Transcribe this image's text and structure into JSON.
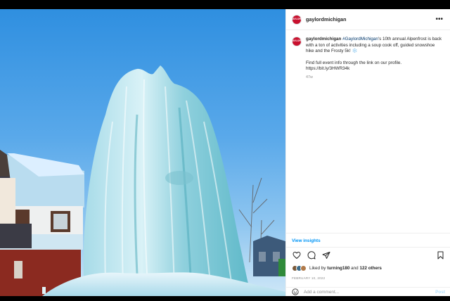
{
  "post": {
    "username": "gaylordmichigan",
    "avatar_text": "GAYLORD",
    "brand_color": "#c8102e",
    "caption": {
      "username": "gaylordmichigan",
      "hashtag": "#GaylordMichigan",
      "text_after_hashtag": "'s 10th annual Alpenfrost is back with a ton of activities including a soup cook off, guided snowshoe hike and the Frosty 5k! ❄️",
      "line2": "Find full event info through the link on our profile.",
      "link": "https://bit.ly/3HWR34k",
      "age": "47w"
    },
    "view_insights": "View insights",
    "likes": {
      "prefix": "Liked by",
      "user": "turning180",
      "and": "and",
      "others": "122 others"
    },
    "date": "FEBRUARY 10, 2022",
    "comment": {
      "placeholder": "Add a comment...",
      "post_label": "Post"
    }
  },
  "icons": [
    "more-icon",
    "heart-icon",
    "comment-icon",
    "share-icon",
    "bookmark-icon",
    "emoji-icon"
  ]
}
